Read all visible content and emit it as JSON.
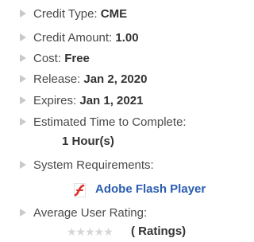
{
  "details": {
    "credit_type": {
      "label": "Credit Type: ",
      "value": "CME"
    },
    "credit_amount": {
      "label": "Credit Amount: ",
      "value": "1.00"
    },
    "cost": {
      "label": "Cost: ",
      "value": "Free"
    },
    "release": {
      "label": "Release: ",
      "value": "Jan 2, 2020"
    },
    "expires": {
      "label": "Expires: ",
      "value": "Jan 1, 2021"
    },
    "estimated_time": {
      "label": "Estimated Time to Complete:",
      "value": "1 Hour(s)"
    },
    "system_requirements": {
      "label": "System Requirements:",
      "link": "Adobe Flash Player",
      "icon": "flash-player-icon"
    },
    "rating": {
      "label": "Average User Rating:",
      "stars": "★★★★★",
      "ratings_text": "( Ratings)"
    }
  },
  "colors": {
    "text": "#4a4a4a",
    "bullet": "#c9c9c9",
    "link": "#2a5db0",
    "flash_red": "#e0302a",
    "star_empty": "#d6d6d6"
  }
}
